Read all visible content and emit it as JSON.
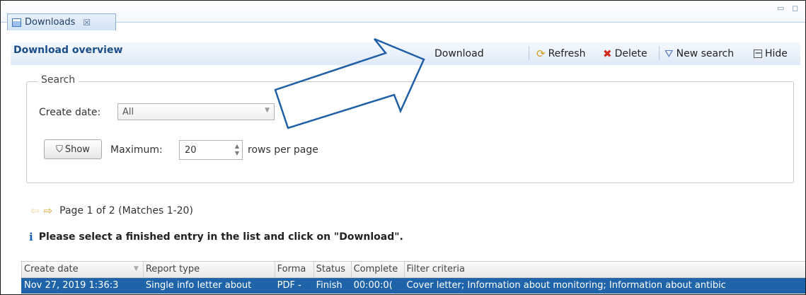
{
  "tab": {
    "title": "Downloads",
    "close": "☒"
  },
  "window_controls": {
    "minimize": "▭",
    "maximize": "◻"
  },
  "panel": {
    "title": "Download overview",
    "toolbar": {
      "download": "Download",
      "refresh": "Refresh",
      "delete": "Delete",
      "new_search": "New search",
      "hide": "Hide"
    }
  },
  "search": {
    "legend": "Search",
    "create_date_label": "Create date:",
    "create_date_value": "All",
    "show_button": "Show",
    "maximum_label": "Maximum:",
    "maximum_value": "20",
    "rows_per_page": "rows per page"
  },
  "pager": {
    "text": "Page 1 of 2 (Matches 1-20)"
  },
  "info": {
    "icon": "i",
    "text": "Please select a finished entry in the list and click on \"Download\"."
  },
  "table": {
    "headers": [
      "Create date",
      "Report type",
      "Forma",
      "Status",
      "Complete",
      "Filter criteria"
    ],
    "rows": [
      [
        "Nov 27, 2019 1:36:3",
        "Single info letter about",
        "PDF -",
        "Finish",
        "00:00:0(",
        "Cover letter; Information about monitoring; Information about antibic"
      ]
    ]
  },
  "colors": {
    "accent": "#1f64a8",
    "title_blue": "#1b4d8a",
    "callout": "#1f5fa8"
  },
  "icons": {
    "tab": "window-icon",
    "refresh": "refresh-icon",
    "delete": "delete-x-icon",
    "new_search": "filter-reset-icon",
    "hide": "collapse-icon",
    "show": "filter-icon",
    "prev": "arrow-left-icon",
    "next": "arrow-right-icon",
    "info": "info-icon"
  }
}
